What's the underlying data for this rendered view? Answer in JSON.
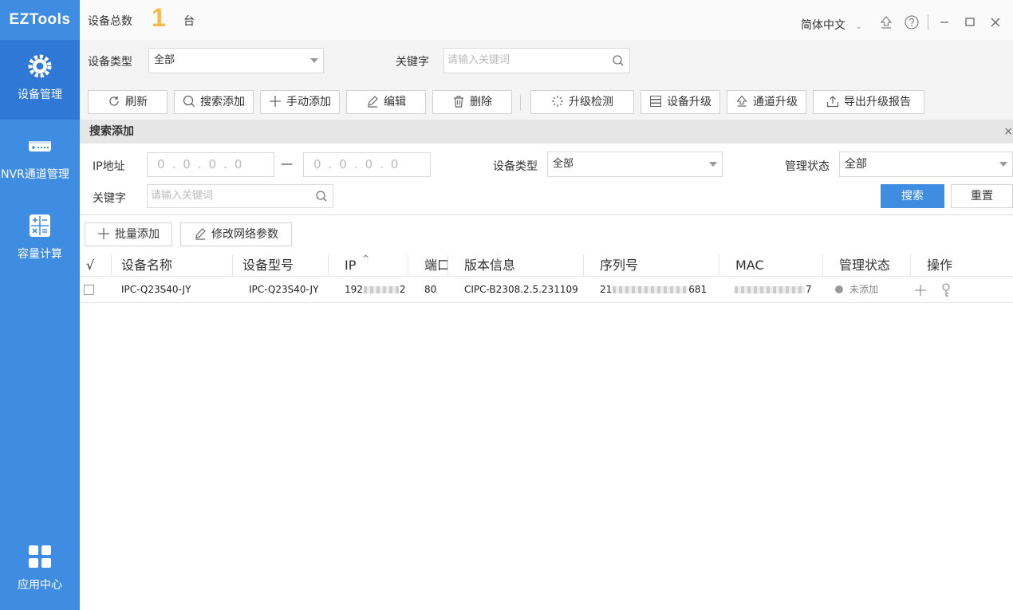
{
  "app": {
    "logo": "EZTools"
  },
  "sidebar": {
    "items": [
      {
        "label": "设备管理",
        "icon": "gear-icon",
        "active": true
      },
      {
        "label": "NVR通道管理",
        "icon": "nvr-device-icon"
      },
      {
        "label": "容量计算",
        "icon": "calculator-icon"
      },
      {
        "label": "应用中心",
        "icon": "app-grid-icon"
      }
    ]
  },
  "topbar": {
    "count_label": "设备总数",
    "count": "1",
    "count_unit": "台",
    "language": "简体中文"
  },
  "filter": {
    "device_type_label": "设备类型",
    "device_type_value": "全部",
    "keyword_label": "关键字",
    "keyword_placeholder": "请输入关键词"
  },
  "toolbar": {
    "refresh": "刷新",
    "search_add": "搜索添加",
    "manual_add": "手动添加",
    "edit": "编辑",
    "delete": "删除",
    "upgrade_check": "升级检测",
    "device_upgrade": "设备升级",
    "channel_upgrade": "通道升级",
    "export_report": "导出升级报告"
  },
  "search_panel": {
    "title": "搜索添加",
    "close": "×",
    "ip_label": "IP地址",
    "ip_start": "0.0.0.0",
    "ip_end": "0.0.0.0",
    "ip_sep": "—",
    "device_type_label": "设备类型",
    "device_type_value": "全部",
    "manage_state_label": "管理状态",
    "manage_state_value": "全部",
    "keyword_label": "关键字",
    "keyword_placeholder": "请输入关键词",
    "search_button": "搜索",
    "reset_button": "重置",
    "batch_add": "批量添加",
    "modify_network": "修改网络参数"
  },
  "table": {
    "headers": [
      "√",
      "设备名称",
      "设备型号",
      "IP",
      "端口",
      "版本信息",
      "序列号",
      "MAC",
      "管理状态",
      "操作"
    ],
    "rows": [
      {
        "name": "IPC-Q23S40-JY",
        "model": "IPC-Q23S40-JY",
        "ip_prefix": "192",
        "ip_suffix": "2",
        "port": "80",
        "version": "CIPC-B2308.2.5.231109",
        "serial_prefix": "21",
        "serial_suffix": "681",
        "mac_suffix": "7",
        "state": "未添加"
      }
    ]
  },
  "colors": {
    "sidebar": "#3f8de3",
    "sidebar_active": "#2f78d6",
    "accent": "#3f8de3",
    "count": "#f7b84a"
  }
}
